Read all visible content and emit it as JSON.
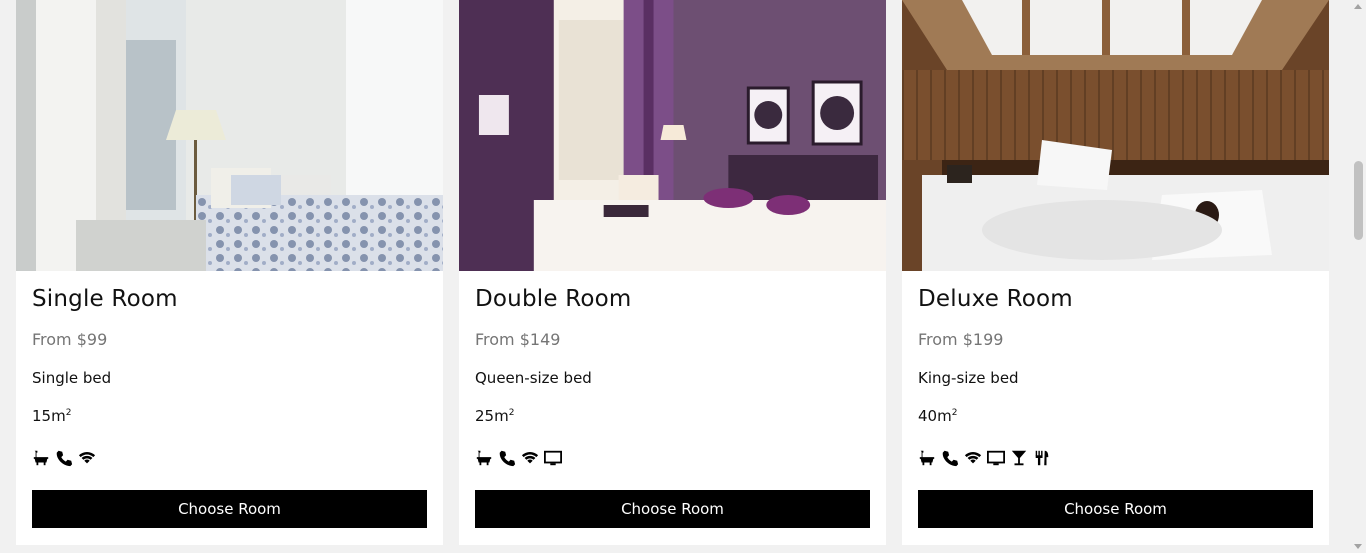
{
  "rooms": [
    {
      "title": "Single Room",
      "price": "From $99",
      "bed": "Single bed",
      "area": "15m",
      "area_sup": "2",
      "amenities": [
        "bath-icon",
        "phone-icon",
        "wifi-icon"
      ],
      "button_label": "Choose Room"
    },
    {
      "title": "Double Room",
      "price": "From $149",
      "bed": "Queen-size bed",
      "area": "25m",
      "area_sup": "2",
      "amenities": [
        "bath-icon",
        "phone-icon",
        "wifi-icon",
        "tv-icon"
      ],
      "button_label": "Choose Room"
    },
    {
      "title": "Deluxe Room",
      "price": "From $199",
      "bed": "King-size bed",
      "area": "40m",
      "area_sup": "2",
      "amenities": [
        "bath-icon",
        "phone-icon",
        "wifi-icon",
        "tv-icon",
        "cocktail-icon",
        "cutlery-icon"
      ],
      "button_label": "Choose Room"
    }
  ],
  "colors": {
    "background": "#f1f1f1",
    "card": "#ffffff",
    "button": "#000000",
    "button_text": "#ffffff",
    "price_text": "#757575"
  }
}
